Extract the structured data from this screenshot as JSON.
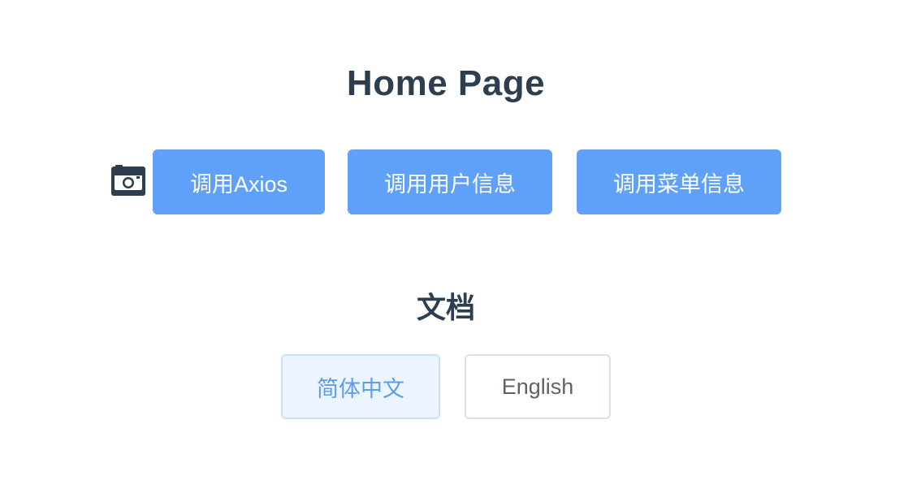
{
  "header": {
    "title": "Home Page"
  },
  "actions": {
    "icon": "camera-icon",
    "buttons": [
      {
        "label": "调用Axios"
      },
      {
        "label": "调用用户信息"
      },
      {
        "label": "调用菜单信息"
      }
    ],
    "button_color": "#5fa0f8"
  },
  "docs": {
    "title": "文档",
    "languages": [
      {
        "label": "简体中文",
        "selected": true
      },
      {
        "label": "English",
        "selected": false
      }
    ]
  },
  "colors": {
    "text": "#2c3e50",
    "primary": "#5fa0f8",
    "selected_bg": "#ecf5ff",
    "selected_text": "#5c9ee6"
  }
}
